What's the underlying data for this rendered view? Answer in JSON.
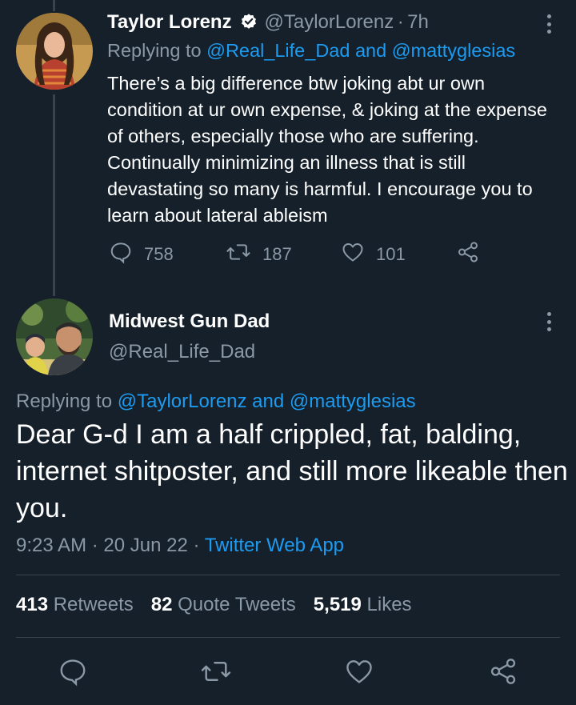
{
  "parent_tweet": {
    "name": "Taylor Lorenz",
    "handle": "@TaylorLorenz",
    "sep": "·",
    "time": "7h",
    "replying_prefix": "Replying to",
    "replying_to": "@Real_Life_Dad and @mattyglesias",
    "text": "There’s a big difference btw joking abt ur own condition at ur own expense, & joking at the expense of others, especially those who are suffering. Continually minimizing an illness that is still devastating so many is harmful. I encourage you to learn about lateral ableism",
    "replies": "758",
    "retweets": "187",
    "likes": "101"
  },
  "main_tweet": {
    "name": "Midwest Gun Dad",
    "handle": "@Real_Life_Dad",
    "replying_prefix": "Replying to",
    "replying_to": "@TaylorLorenz and @mattyglesias",
    "text": "Dear G-d I am a half crippled, fat, balding, internet shitposter, and still more likeable then you.",
    "timestamp": "9:23 AM · 20 Jun 22 · ",
    "source": "Twitter Web App",
    "stats": {
      "retweets_count": "413",
      "retweets_label": "Retweets",
      "quotes_count": "82",
      "quotes_label": "Quote Tweets",
      "likes_count": "5,519",
      "likes_label": "Likes"
    }
  },
  "icons": {
    "reply": "reply-icon",
    "retweet": "retweet-icon",
    "like": "heart-icon",
    "share": "share-icon",
    "more": "more-icon",
    "verified": "verified-badge-icon"
  },
  "colors": {
    "background": "#15202b",
    "accent": "#1d9bf0",
    "muted": "#8b98a5",
    "divider": "#38444d"
  }
}
